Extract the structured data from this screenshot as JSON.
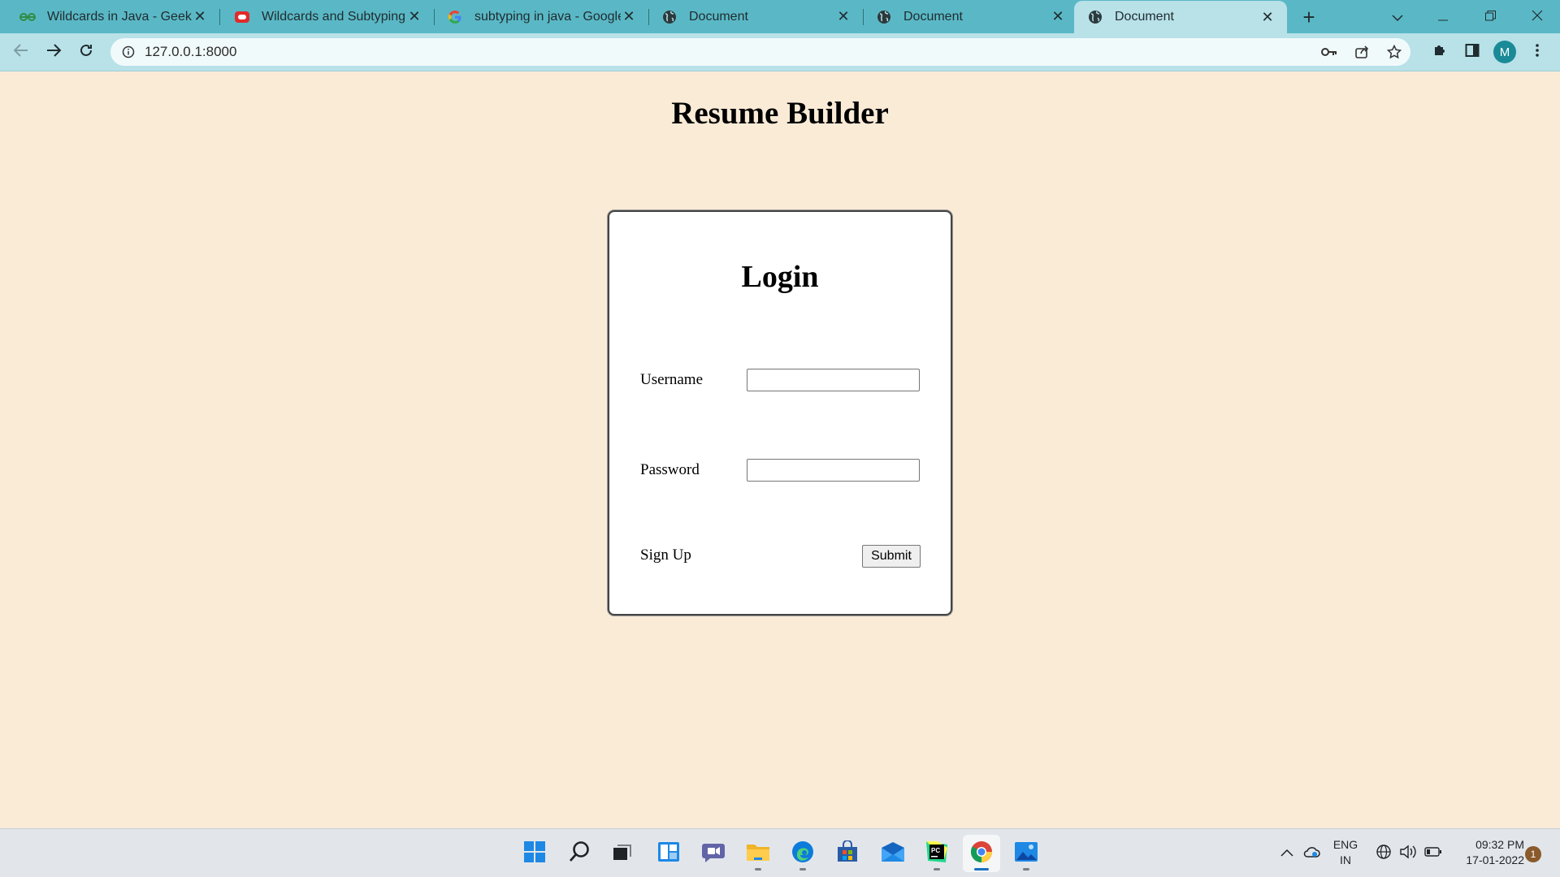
{
  "browser": {
    "tabs": [
      {
        "title": "Wildcards in Java - GeeksforGeeks",
        "favicon": "geeksforgeeks-icon",
        "active": false
      },
      {
        "title": "Wildcards and Subtyping (The Java",
        "favicon": "oracle-icon",
        "active": false
      },
      {
        "title": "subtyping in java - Google Search",
        "favicon": "google-icon",
        "active": false
      },
      {
        "title": "Document",
        "favicon": "globe-icon",
        "active": false
      },
      {
        "title": "Document",
        "favicon": "globe-icon",
        "active": false
      },
      {
        "title": "Document",
        "favicon": "globe-icon",
        "active": true
      }
    ],
    "url": "127.0.0.1:8000",
    "profile_initial": "M"
  },
  "page": {
    "title": "Resume Builder",
    "login": {
      "heading": "Login",
      "username_label": "Username",
      "username_value": "",
      "password_label": "Password",
      "password_value": "",
      "signup_label": "Sign Up",
      "submit_label": "Submit"
    }
  },
  "taskbar": {
    "apps": [
      "start-icon",
      "search-icon",
      "task-view-icon",
      "widgets-icon",
      "teams-chat-icon",
      "file-explorer-icon",
      "edge-icon",
      "store-icon",
      "mail-icon",
      "pycharm-icon",
      "chrome-icon",
      "photos-icon"
    ],
    "language": "ENG",
    "region": "IN",
    "time": "09:32 PM",
    "date": "17-01-2022",
    "notification_count": "1"
  },
  "colors": {
    "tabstrip": "#5ab8c6",
    "toolbar": "#b8e1e8",
    "page_background": "#faebd7",
    "card_background": "#ffffff"
  }
}
